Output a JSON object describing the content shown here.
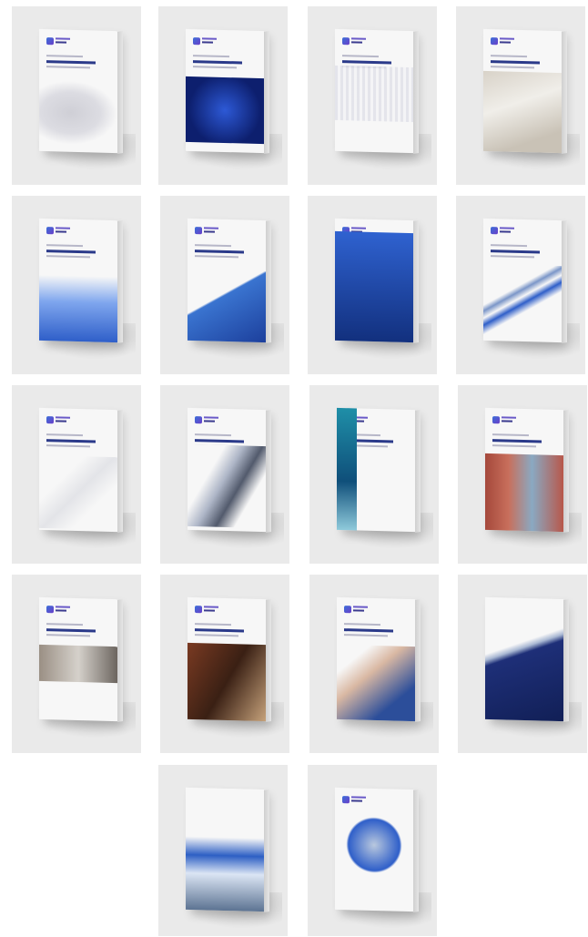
{
  "grid": {
    "books": [
      {
        "name": "cover-map-ukraine",
        "art": "map"
      },
      {
        "name": "cover-blue-network",
        "art": "blue-square"
      },
      {
        "name": "cover-world-map",
        "art": "worldmap"
      },
      {
        "name": "cover-handshake-docs",
        "art": "photo-light"
      },
      {
        "name": "cover-blue-skyline",
        "art": "skyline"
      },
      {
        "name": "cover-glass-building",
        "art": "glass"
      },
      {
        "name": "cover-dark-blue-city",
        "art": "dark-blue"
      },
      {
        "name": "cover-arrows-growth",
        "art": "arrows"
      },
      {
        "name": "cover-white-geometry",
        "art": "white-geo"
      },
      {
        "name": "cover-skyscraper",
        "art": "skyscraper"
      },
      {
        "name": "cover-teal-triangles",
        "art": "teal"
      },
      {
        "name": "cover-containers",
        "art": "containers"
      },
      {
        "name": "cover-business-meeting",
        "art": "meeting"
      },
      {
        "name": "cover-justice-scales",
        "art": "scales"
      },
      {
        "name": "cover-handshake-blue",
        "art": "handshake"
      },
      {
        "name": "cover-navy-diagonal",
        "art": "navy"
      },
      {
        "name": "cover-port-cranes",
        "art": "port"
      },
      {
        "name": "cover-circle-photo",
        "art": "circle"
      }
    ]
  },
  "colors": {
    "tile_bg": "#eaeaea",
    "brand_blue": "#2f5fc9",
    "navy": "#1e2f78",
    "teal": "#1f8fa8"
  }
}
